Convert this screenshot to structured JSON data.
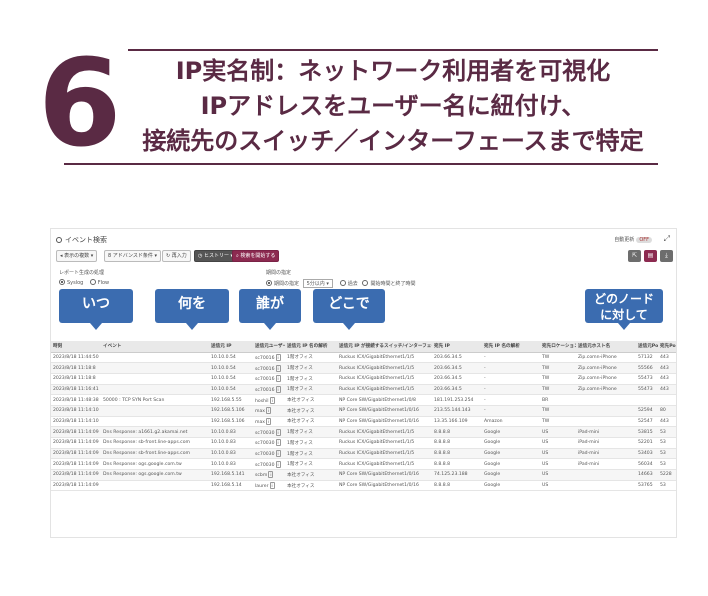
{
  "banner": {
    "number": "6",
    "lines": [
      "IP実名制：ネットワーク利用者を可視化",
      "IPアドレスをユーザー名に紐付け、",
      "接続先のスイッチ／インターフェースまで特定"
    ]
  },
  "window": {
    "title": "イベント検索",
    "auto_refresh_label": "自動更新",
    "auto_refresh_state": "OFF"
  },
  "toolbar": {
    "buttons": [
      "表示の複数",
      "8 アドバンスド条件",
      "再入力",
      "ヒストリー",
      "検索を開始する"
    ]
  },
  "options": {
    "report_label": "レポート生成の処理",
    "report_radio": [
      "Syslog",
      "Flow"
    ],
    "period_label": "期間の指定",
    "period_options": [
      "期間の指定",
      "5分以内",
      "過去",
      "開始時間と終了時間"
    ]
  },
  "callouts": [
    "いつ",
    "何を",
    "誰が",
    "どこで",
    "どのノード\nに対して"
  ],
  "table": {
    "columns": [
      "時刻",
      "イベント",
      "送信元 IP",
      "送信元ユーザー",
      "送信元 IP 名の解析",
      "送信元 IP が接続するスイッチ/インターフェース",
      "宛先 IP",
      "宛先 IP 名の解析",
      "宛先ロケーション",
      "送信元ホスト名",
      "送信元Port",
      "宛先Port"
    ],
    "rows": [
      [
        "2023/8/18 11:44:50",
        "",
        "10.10.0.54",
        "sc70016",
        "1階オフィス",
        "Ruckus ICX/GigabitEthernet1/1/5",
        "203.66.34.5",
        "-",
        "TW",
        "Zip.comn-iPhone",
        "57132",
        "443"
      ],
      [
        "2023/8/18 11:18:8",
        "",
        "10.10.0.54",
        "sc70016",
        "1階オフィス",
        "Ruckus ICX/GigabitEthernet1/1/5",
        "203.66.34.5",
        "-",
        "TW",
        "Zip.comn-iPhone",
        "55566",
        "443"
      ],
      [
        "2023/8/18 11:18:8",
        "",
        "10.10.0.54",
        "sc70016",
        "1階オフィス",
        "Ruckus ICX/GigabitEthernet1/1/5",
        "203.66.34.5",
        "-",
        "TW",
        "Zip.comn-iPhone",
        "55473",
        "443"
      ],
      [
        "2023/8/18 11:16:41",
        "",
        "10.10.0.54",
        "sc70016",
        "1階オフィス",
        "Ruckus ICX/GigabitEthernet1/1/5",
        "203.66.34.5",
        "-",
        "TW",
        "Zip.comn-iPhone",
        "55473",
        "443"
      ],
      [
        "2023/8/18 11:48:38",
        "50000 : TCP SYN Port Scan",
        "192.168.5.55",
        "hoshil",
        "本社オフィス",
        "NP Core SW/GigabitEthernet1/0/8",
        "181.191.253.254",
        "-",
        "BR",
        "",
        "",
        ""
      ],
      [
        "2023/8/18 11:14:10",
        "",
        "192.168.5.106",
        "max",
        "本社オフィス",
        "NP Core SW/GigabitEthernet1/0/16",
        "213.55.144.143",
        "-",
        "TW",
        "",
        "52594",
        "80"
      ],
      [
        "2023/8/18 11:14:10",
        "",
        "192.168.5.106",
        "max",
        "本社オフィス",
        "NP Core SW/GigabitEthernet1/0/16",
        "13.35.166.109",
        "Amazon",
        "TW",
        "",
        "52547",
        "443"
      ],
      [
        "2023/8/18 11:14:09",
        "Dns Response: a1661.g2.akamai.net",
        "10.10.0.83",
        "sc70030",
        "1階オフィス",
        "Ruckus ICX/GigabitEthernet1/1/5",
        "8.8.8.8",
        "Google",
        "US",
        "iPad-mini",
        "53815",
        "53"
      ],
      [
        "2023/8/18 11:14:09",
        "Dns Response: sb-front.line-apps.com",
        "10.10.0.83",
        "sc70030",
        "1階オフィス",
        "Ruckus ICX/GigabitEthernet1/1/5",
        "8.8.8.8",
        "Google",
        "US",
        "iPad-mini",
        "52201",
        "53"
      ],
      [
        "2023/8/18 11:14:09",
        "Dns Response: sb-front.line-apps.com",
        "10.10.0.83",
        "sc70030",
        "1階オフィス",
        "Ruckus ICX/GigabitEthernet1/1/5",
        "8.8.8.8",
        "Google",
        "US",
        "iPad-mini",
        "53403",
        "53"
      ],
      [
        "2023/8/18 11:14:09",
        "Dns Response: ogs.google.com.tw",
        "10.10.0.83",
        "sc70030",
        "1階オフィス",
        "Ruckus ICX/GigabitEthernet1/1/5",
        "8.8.8.8",
        "Google",
        "US",
        "iPad-mini",
        "56034",
        "53"
      ],
      [
        "2023/8/18 11:14:09",
        "Dns Response: ogs.google.com.tw",
        "192.168.5.141",
        "scbm",
        "本社オフィス",
        "NP Core SW/GigabitEthernet1/0/16",
        "74.125.23.188",
        "Google",
        "US",
        "",
        "14663",
        "5228"
      ],
      [
        "2023/8/18 11:14:09",
        "",
        "192.168.5.14",
        "laurer",
        "本社オフィス",
        "NP Core SW/GigabitEthernet1/0/16",
        "8.8.8.8",
        "Google",
        "US",
        "",
        "53765",
        "53"
      ]
    ]
  },
  "colors": {
    "brand": "#5a2a44",
    "callout": "#3b6cb0",
    "link": "#3a6fb5",
    "alert": "#d3302f"
  }
}
